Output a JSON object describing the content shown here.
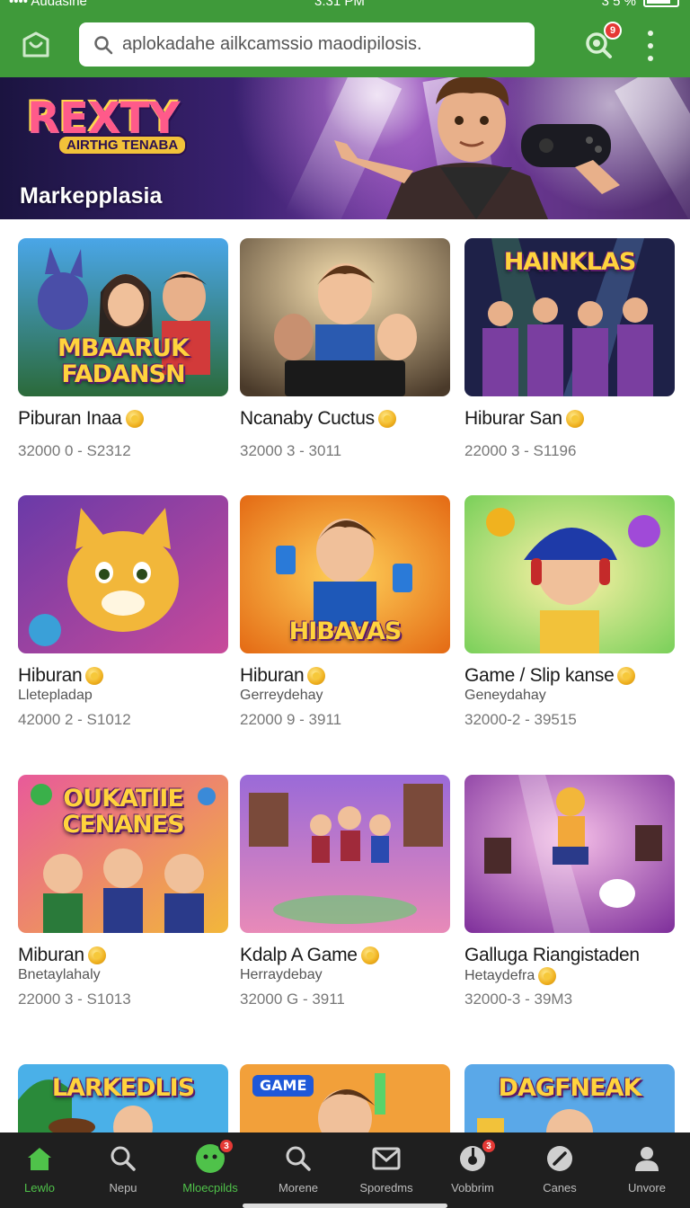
{
  "status_bar": {
    "carrier": "•••• Audasine",
    "time": "3:31 PM",
    "right": "3 5 %"
  },
  "app_bar": {
    "search_placeholder": "aplokadahe ailkcamssio maodipilosis.",
    "scan_badge": "9",
    "accent": "#3f9a3a"
  },
  "banner": {
    "logo_word": "REXTY",
    "logo_sub": "AIRTHG TENABA",
    "title": "Markepplasia"
  },
  "cards": [
    {
      "name": "Piburan Inaa",
      "coin": true,
      "sub": "",
      "price": "32000 0 - S2312",
      "thumb_text": "MBAARUK FADANSN"
    },
    {
      "name": "Ncanaby Cuctus",
      "coin": true,
      "sub": "",
      "price": "32000 3 - 3011",
      "thumb_text": ""
    },
    {
      "name": "Hiburar San",
      "coin": true,
      "sub": "",
      "price": "22000 3 - S1196",
      "thumb_text": "HAINKLAS"
    },
    {
      "name": "Hiburan",
      "coin": true,
      "sub": "Lletepladap",
      "price": "42000 2 - S1012",
      "thumb_text": ""
    },
    {
      "name": "Hiburan",
      "coin": true,
      "sub": "Gerreydehay",
      "price": "22000 9 - 3911",
      "thumb_text": "HIBAVAS"
    },
    {
      "name": "Game / Slip kanse",
      "coin": true,
      "sub": "Geneydahay",
      "price": "32000-2 - 39515",
      "thumb_text": ""
    },
    {
      "name": "Miburan",
      "coin": true,
      "sub": "Bnetaylahaly",
      "price": "22000 3 - S1013",
      "thumb_text": "OUKATIIE CENANES"
    },
    {
      "name": "Kdalp A Game",
      "coin": true,
      "sub": "Herraydebay",
      "price": "32000 G - 3911",
      "thumb_text": ""
    },
    {
      "name": "Galluga Riangistaden",
      "coin": false,
      "sub": "Hetaydefra",
      "sub_coin": true,
      "price": "32000-3 - 39M3",
      "thumb_text": ""
    },
    {
      "name": "",
      "coin": false,
      "sub": "",
      "price": "",
      "thumb_text": "LARKEDLIS"
    },
    {
      "name": "",
      "coin": false,
      "sub": "",
      "price": "",
      "thumb_text": "GAME"
    },
    {
      "name": "",
      "coin": false,
      "sub": "",
      "price": "",
      "thumb_text": "DAGFNEAK"
    }
  ],
  "bottom_nav": [
    {
      "label": "Lewlo",
      "icon": "home-icon",
      "badge": ""
    },
    {
      "label": "Nepu",
      "icon": "search-icon",
      "badge": ""
    },
    {
      "label": "Mloecpilds",
      "icon": "marketplace-icon",
      "badge": "3",
      "active": true
    },
    {
      "label": "Morene",
      "icon": "search-icon",
      "badge": ""
    },
    {
      "label": "Sporedms",
      "icon": "mail-icon",
      "badge": ""
    },
    {
      "label": "Vobbrim",
      "icon": "gamepad-icon",
      "badge": "3"
    },
    {
      "label": "Canes",
      "icon": "compass-icon",
      "badge": ""
    },
    {
      "label": "Unvore",
      "icon": "person-icon",
      "badge": ""
    }
  ]
}
